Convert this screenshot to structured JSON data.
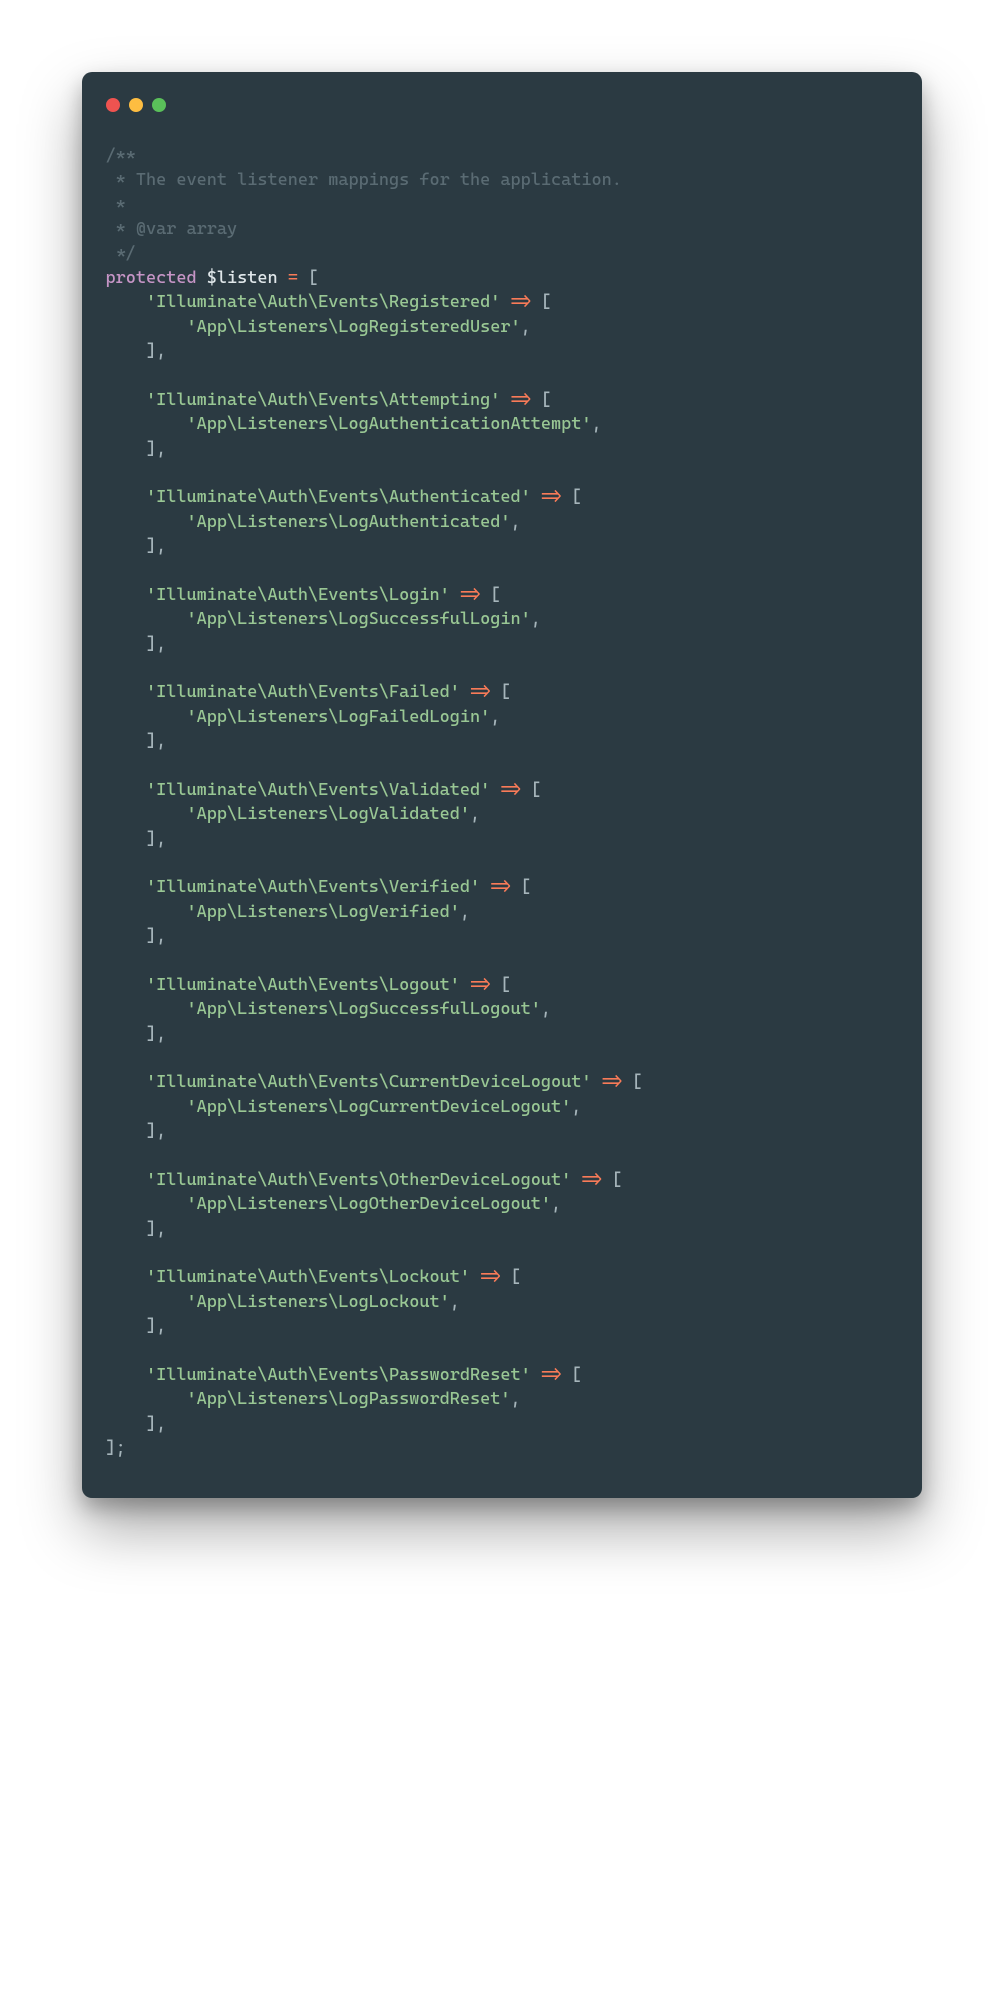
{
  "colors": {
    "window_bg": "#2b3a42",
    "comment": "#5a6b73",
    "keyword": "#c695c6",
    "string": "#99c794",
    "operator": "#f97b58",
    "punct": "#a6b5bb",
    "text": "#e0e7ea",
    "dot_red": "#ef5350",
    "dot_yellow": "#fdbd41",
    "dot_green": "#5ac05a"
  },
  "comment": {
    "l1": "/**",
    "l2": " * The event listener mappings for the application.",
    "l3": " *",
    "l4": " * @var array",
    "l5": " */"
  },
  "decl": {
    "keyword": "protected",
    "var": "$listen",
    "eq": "=",
    "open": "[",
    "close": "];"
  },
  "arrow": "=>",
  "br_open": "[",
  "br_close": "],",
  "comma": ",",
  "entries": [
    {
      "event": "'Illuminate\\Auth\\Events\\Registered'",
      "listener": "'App\\Listeners\\LogRegisteredUser'"
    },
    {
      "event": "'Illuminate\\Auth\\Events\\Attempting'",
      "listener": "'App\\Listeners\\LogAuthenticationAttempt'"
    },
    {
      "event": "'Illuminate\\Auth\\Events\\Authenticated'",
      "listener": "'App\\Listeners\\LogAuthenticated'"
    },
    {
      "event": "'Illuminate\\Auth\\Events\\Login'",
      "listener": "'App\\Listeners\\LogSuccessfulLogin'"
    },
    {
      "event": "'Illuminate\\Auth\\Events\\Failed'",
      "listener": "'App\\Listeners\\LogFailedLogin'"
    },
    {
      "event": "'Illuminate\\Auth\\Events\\Validated'",
      "listener": "'App\\Listeners\\LogValidated'"
    },
    {
      "event": "'Illuminate\\Auth\\Events\\Verified'",
      "listener": "'App\\Listeners\\LogVerified'"
    },
    {
      "event": "'Illuminate\\Auth\\Events\\Logout'",
      "listener": "'App\\Listeners\\LogSuccessfulLogout'"
    },
    {
      "event": "'Illuminate\\Auth\\Events\\CurrentDeviceLogout'",
      "listener": "'App\\Listeners\\LogCurrentDeviceLogout'"
    },
    {
      "event": "'Illuminate\\Auth\\Events\\OtherDeviceLogout'",
      "listener": "'App\\Listeners\\LogOtherDeviceLogout'"
    },
    {
      "event": "'Illuminate\\Auth\\Events\\Lockout'",
      "listener": "'App\\Listeners\\LogLockout'"
    },
    {
      "event": "'Illuminate\\Auth\\Events\\PasswordReset'",
      "listener": "'App\\Listeners\\LogPasswordReset'"
    }
  ]
}
